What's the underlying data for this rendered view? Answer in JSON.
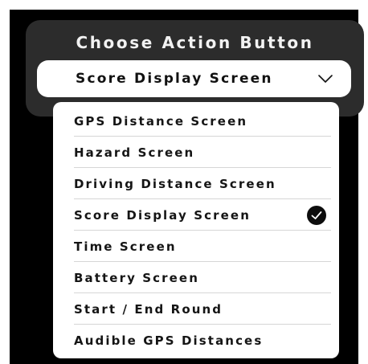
{
  "dialog": {
    "title": "Choose Action Button",
    "selected_value": "Score Display Screen",
    "dropdown_icon": "chevron-down-icon"
  },
  "menu": {
    "items": [
      {
        "label": "GPS Distance Screen",
        "selected": false
      },
      {
        "label": "Hazard Screen",
        "selected": false
      },
      {
        "label": "Driving Distance Screen",
        "selected": false
      },
      {
        "label": "Score Display Screen",
        "selected": true,
        "icon": "checkmark-circle-icon"
      },
      {
        "label": "Time Screen",
        "selected": false
      },
      {
        "label": "Battery Screen",
        "selected": false
      },
      {
        "label": "Start / End Round",
        "selected": false
      },
      {
        "label": "Audible GPS Distances",
        "selected": false
      }
    ]
  },
  "colors": {
    "background": "#000000",
    "panel": "#2c2c2c",
    "surface": "#ffffff",
    "text_dark": "#151515",
    "text_light": "#f2f2f2",
    "divider": "#d6d6d6"
  }
}
